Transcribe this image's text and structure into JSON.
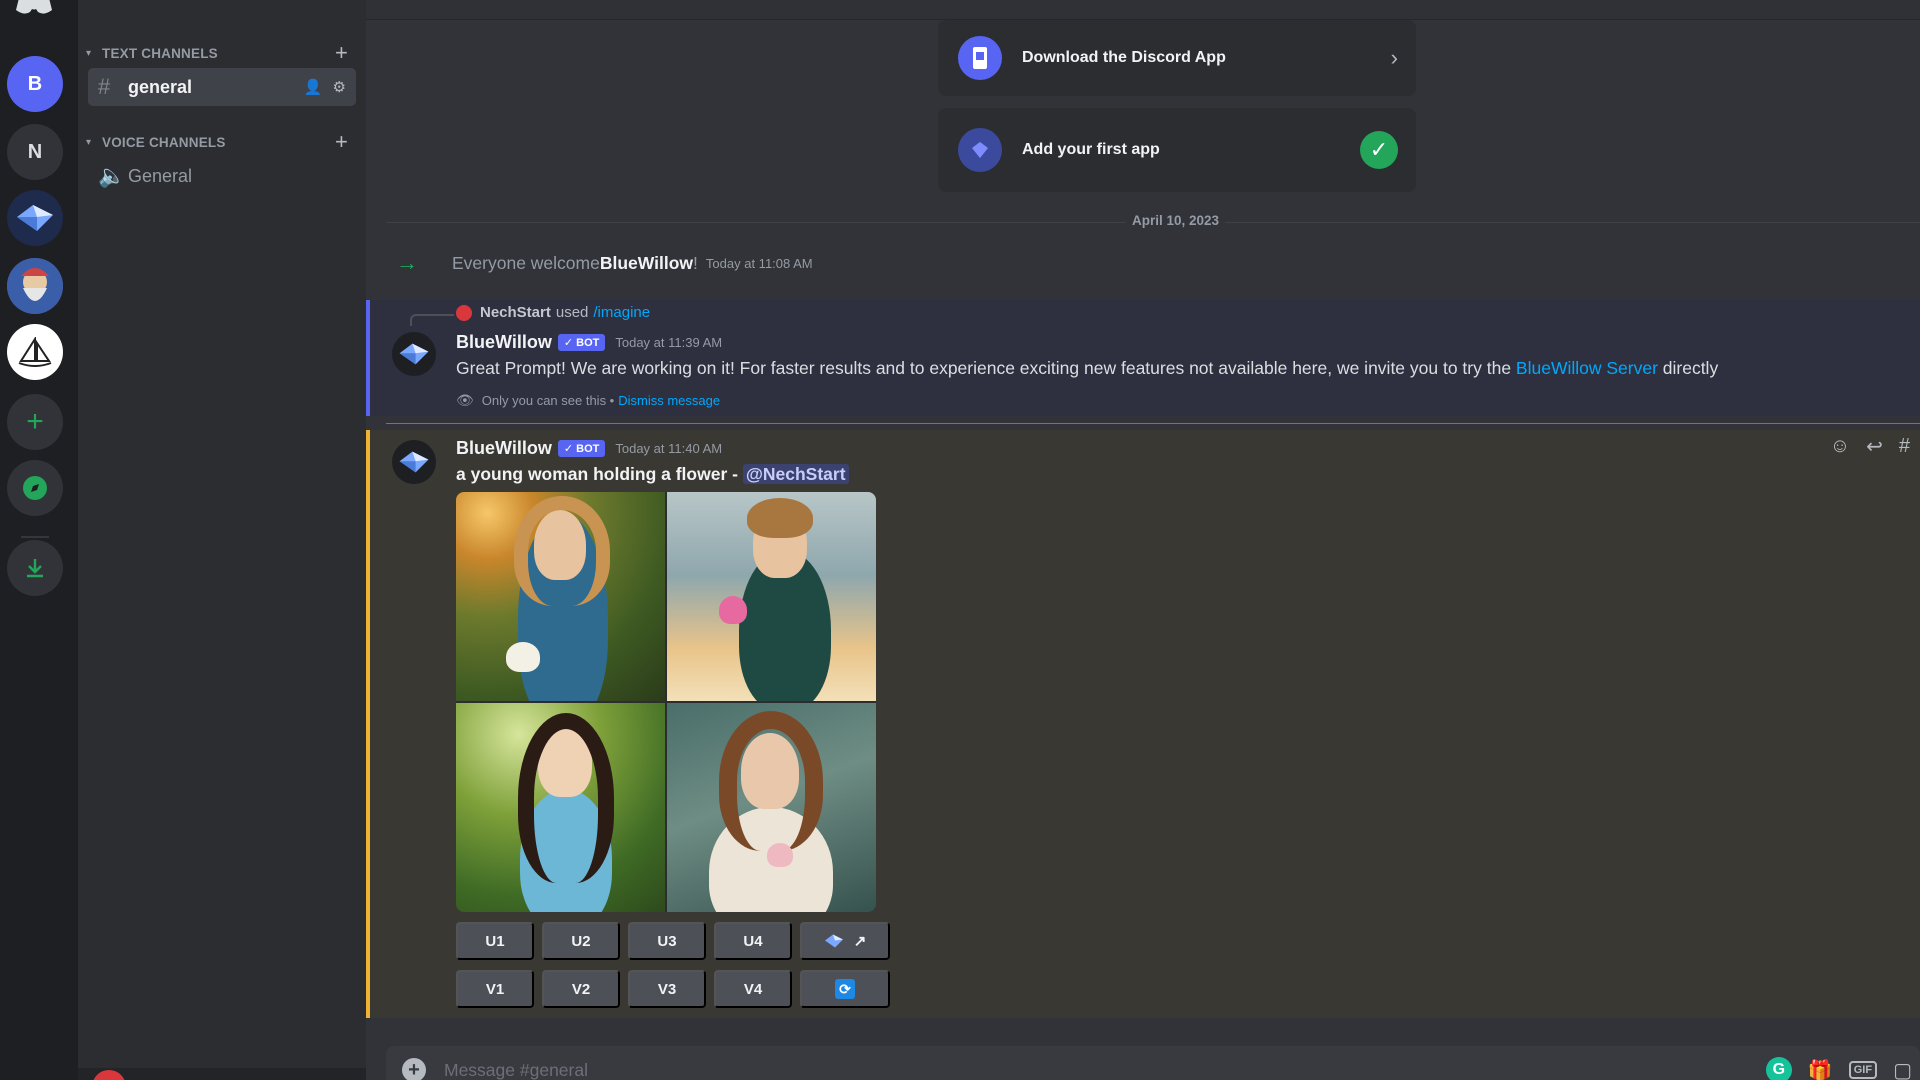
{
  "rail": {
    "servers": [
      {
        "label": "B",
        "name": "server-b"
      },
      {
        "label": "N",
        "name": "server-n"
      }
    ]
  },
  "sidebar": {
    "text_category": "TEXT CHANNELS",
    "voice_category": "VOICE CHANNELS",
    "text_channels": [
      {
        "label": "general"
      }
    ],
    "voice_channels": [
      {
        "label": "General"
      }
    ]
  },
  "cards": {
    "download": "Download the Discord App",
    "first_app": "Add your first app"
  },
  "divider": "April 10, 2023",
  "join": {
    "prefix": "Everyone welcome ",
    "user": "BlueWillow",
    "suffix": "!",
    "time": "Today at 11:08 AM"
  },
  "message1": {
    "reply_user": "NechStart",
    "reply_used": "used",
    "reply_command": "/imagine",
    "author": "BlueWillow",
    "bot_tag": "BOT",
    "time": "Today at 11:39 AM",
    "text_before": "Great Prompt! We are working on it! For faster results and to experience exciting new features not available here, we invite you to try the ",
    "link": "BlueWillow Server",
    "text_after": " directly",
    "ephemeral": "Only you can see this •",
    "dismiss": "Dismiss message"
  },
  "message2": {
    "author": "BlueWillow",
    "bot_tag": "BOT",
    "time": "Today at 11:40 AM",
    "prompt": "a young woman holding a flower",
    "separator": " - ",
    "mention": "@NechStart",
    "upscale_buttons": [
      "U1",
      "U2",
      "U3",
      "U4"
    ],
    "variation_buttons": [
      "V1",
      "V2",
      "V3",
      "V4"
    ]
  },
  "composer": {
    "placeholder": "Message #general",
    "gif": "GIF"
  },
  "colors": {
    "blurple": "#5865f2",
    "green": "#23a55a",
    "highlight": "#f0b232",
    "link": "#00a8fc"
  }
}
